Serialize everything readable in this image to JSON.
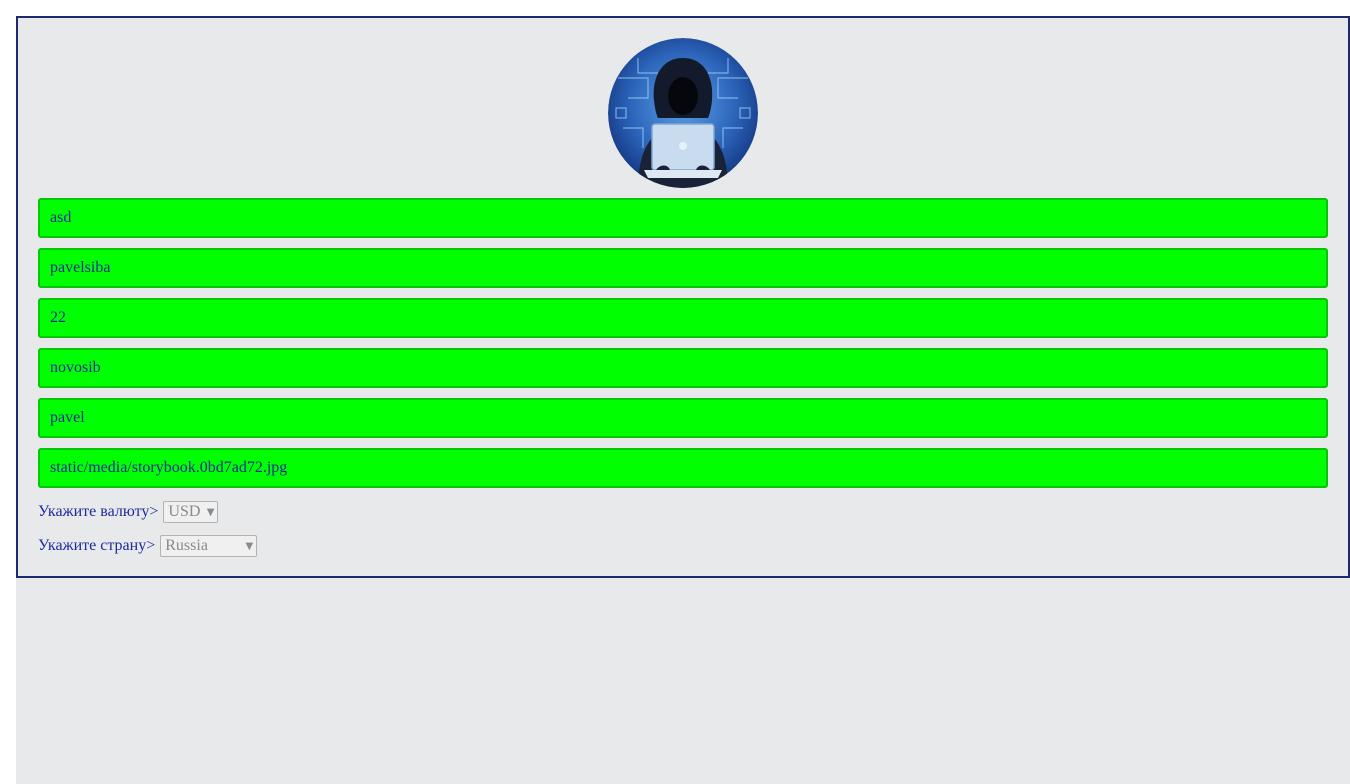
{
  "profile": {
    "avatar": "hooded-hacker-avatar",
    "fields": [
      {
        "name": "field-asd",
        "value": "asd"
      },
      {
        "name": "field-username",
        "value": "pavelsiba"
      },
      {
        "name": "field-age",
        "value": "22"
      },
      {
        "name": "field-city",
        "value": "novosib"
      },
      {
        "name": "field-name",
        "value": "pavel"
      },
      {
        "name": "field-image-path",
        "value": "static/media/storybook.0bd7ad72.jpg"
      }
    ]
  },
  "currency": {
    "label": "Укажите валюту>",
    "selected": "USD"
  },
  "country": {
    "label": "Укажите страну>",
    "selected": "Russia"
  },
  "colors": {
    "field_bg": "#00ff00",
    "field_border": "#06c406",
    "text": "#1c2a9c",
    "card_border": "#1c2a6b",
    "background": "#e8e9eb"
  }
}
